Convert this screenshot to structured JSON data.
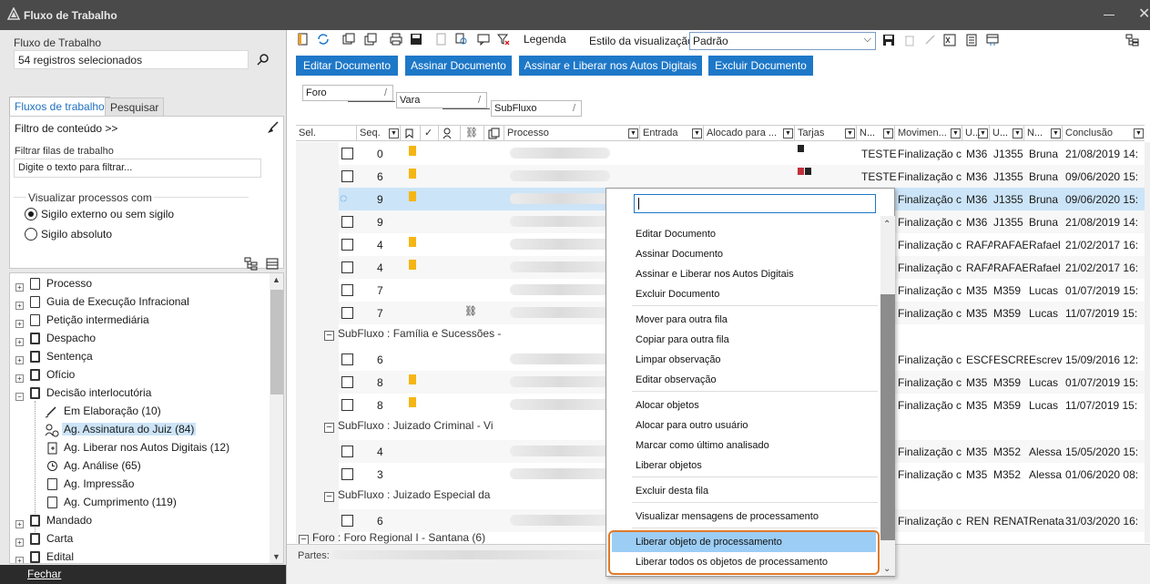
{
  "window": {
    "title": "Fluxo de Trabalho"
  },
  "left": {
    "flow_label": "Fluxo de Trabalho",
    "records_value": "54 registros selecionados",
    "tabs": [
      "Fluxos de trabalho",
      "Pesquisar"
    ],
    "filter_link": "Filtro de conteúdo >>",
    "filter_queues_label": "Filtrar filas de trabalho",
    "filter_placeholder": "Digite o texto para filtrar...",
    "visualize_label": "Visualizar processos com",
    "radio_external": "Sigilo externo ou sem sigilo",
    "radio_absolute": "Sigilo absoluto",
    "tree": [
      "Processo",
      "Guia de Execução Infracional",
      "Petição intermediária",
      "Despacho",
      "Sentença",
      "Ofício",
      "Decisão interlocutória",
      "Em Elaboração (10)",
      "Ag. Assinatura do Juiz (84)",
      "Ag. Liberar nos Autos Digitais (12)",
      "Ag. Análise (65)",
      "Ag. Impressão",
      "Ag. Cumprimento (119)",
      "Mandado",
      "Carta",
      "Edital"
    ],
    "close": "Fechar"
  },
  "toolbar": {
    "legend": "Legenda",
    "style_label": "Estilo da visualização",
    "style_value": "Padrão"
  },
  "buttons": [
    "Editar Documento",
    "Assinar Documento",
    "Assinar e Liberar nos Autos Digitais",
    "Excluir Documento"
  ],
  "group": {
    "foro": "Foro",
    "vara": "Vara",
    "subfluxo": "SubFluxo"
  },
  "columns": [
    "Sel.",
    "Seq.",
    "Processo",
    "Entrada",
    "Alocado para ...",
    "Tarjas",
    "N...",
    "Movimen...",
    "U...",
    "U...",
    "N...",
    "Conclusão"
  ],
  "rows": [
    {
      "seq": "0",
      "flag": true,
      "n": "TESTE",
      "mov": "Finalização c",
      "u1": "M36",
      "u2": "J1355",
      "name": "Bruna",
      "date": "21/08/2019 14:"
    },
    {
      "seq": "6",
      "flag": true,
      "n": "TESTE",
      "mov": "Finalização c",
      "u1": "M36",
      "u2": "J1355",
      "name": "Bruna",
      "date": "09/06/2020 15:"
    },
    {
      "seq": "9",
      "flag": true,
      "n": "",
      "mov": "Finalização c",
      "u1": "M36",
      "u2": "J1355",
      "name": "Bruna",
      "date": "09/06/2020 15:"
    },
    {
      "seq": "9",
      "flag": false,
      "n": "",
      "mov": "Finalização c",
      "u1": "M36",
      "u2": "J1355",
      "name": "Bruna",
      "date": "21/08/2019 14:"
    },
    {
      "seq": "4",
      "flag": true,
      "n": "",
      "mov": "Finalização c",
      "u1": "RAFA",
      "u2": "RAFAE",
      "name": "Rafael",
      "date": "21/02/2017 16:"
    },
    {
      "seq": "4",
      "flag": true,
      "n": "",
      "mov": "Finalização c",
      "u1": "RAFA",
      "u2": "RAFAE",
      "name": "Rafael",
      "date": "21/02/2017 16:"
    },
    {
      "seq": "7",
      "flag": false,
      "n": "",
      "mov": "Finalização c",
      "u1": "M35",
      "u2": "M359",
      "name": "Lucas",
      "date": "01/07/2019 15:"
    },
    {
      "seq": "7",
      "flag": false,
      "n": "",
      "mov": "Finalização c",
      "u1": "M35",
      "u2": "M359",
      "name": "Lucas",
      "date": "11/07/2019 15:"
    },
    {
      "seq": "6",
      "flag": false,
      "n": "",
      "mov": "Finalização c",
      "u1": "ESCF",
      "u2": "ESCRE",
      "name": "Escrev",
      "date": "15/09/2016 12:"
    },
    {
      "seq": "8",
      "flag": true,
      "n": "",
      "mov": "Finalização c",
      "u1": "M35",
      "u2": "M359",
      "name": "Lucas",
      "date": "01/07/2019 15:"
    },
    {
      "seq": "8",
      "flag": true,
      "n": "",
      "mov": "Finalização c",
      "u1": "M35",
      "u2": "M359",
      "name": "Lucas",
      "date": "11/07/2019 15:"
    },
    {
      "seq": "4",
      "flag": false,
      "n": "",
      "mov": "Finalização c",
      "u1": "M35",
      "u2": "M352",
      "name": "Alessa",
      "date": "15/05/2020 15:"
    },
    {
      "seq": "3",
      "flag": false,
      "n": "",
      "mov": "Finalização c",
      "u1": "M35",
      "u2": "M352",
      "name": "Alessa",
      "date": "01/06/2020 08:"
    },
    {
      "seq": "6",
      "flag": false,
      "n": "",
      "mov": "Finalização c",
      "u1": "REN",
      "u2": "RENAT",
      "name": "Renata",
      "date": "31/03/2020 16:"
    }
  ],
  "subflux": [
    "SubFluxo : Família e Sucessões -",
    "SubFluxo : Juizado Criminal - Vi",
    "SubFluxo : Juizado Especial da",
    "Foro : Foro Regional I - Santana  (6)"
  ],
  "partes_label": "Partes:",
  "menu": [
    "Editar Documento",
    "Assinar Documento",
    "Assinar e Liberar nos Autos Digitais",
    "Excluir Documento",
    "Mover para outra fila",
    "Copiar para outra fila",
    "Limpar observação",
    "Editar observação",
    "Alocar objetos",
    "Alocar para outro usuário",
    "Marcar como último analisado",
    "Liberar objetos",
    "Excluir desta fila",
    "Visualizar mensagens de processamento",
    "Liberar objeto de processamento",
    "Liberar todos os objetos de processamento"
  ],
  "colors": {
    "accent": "#1e78c8",
    "flag": "#f5b614",
    "highlight": "#e07a2a"
  }
}
